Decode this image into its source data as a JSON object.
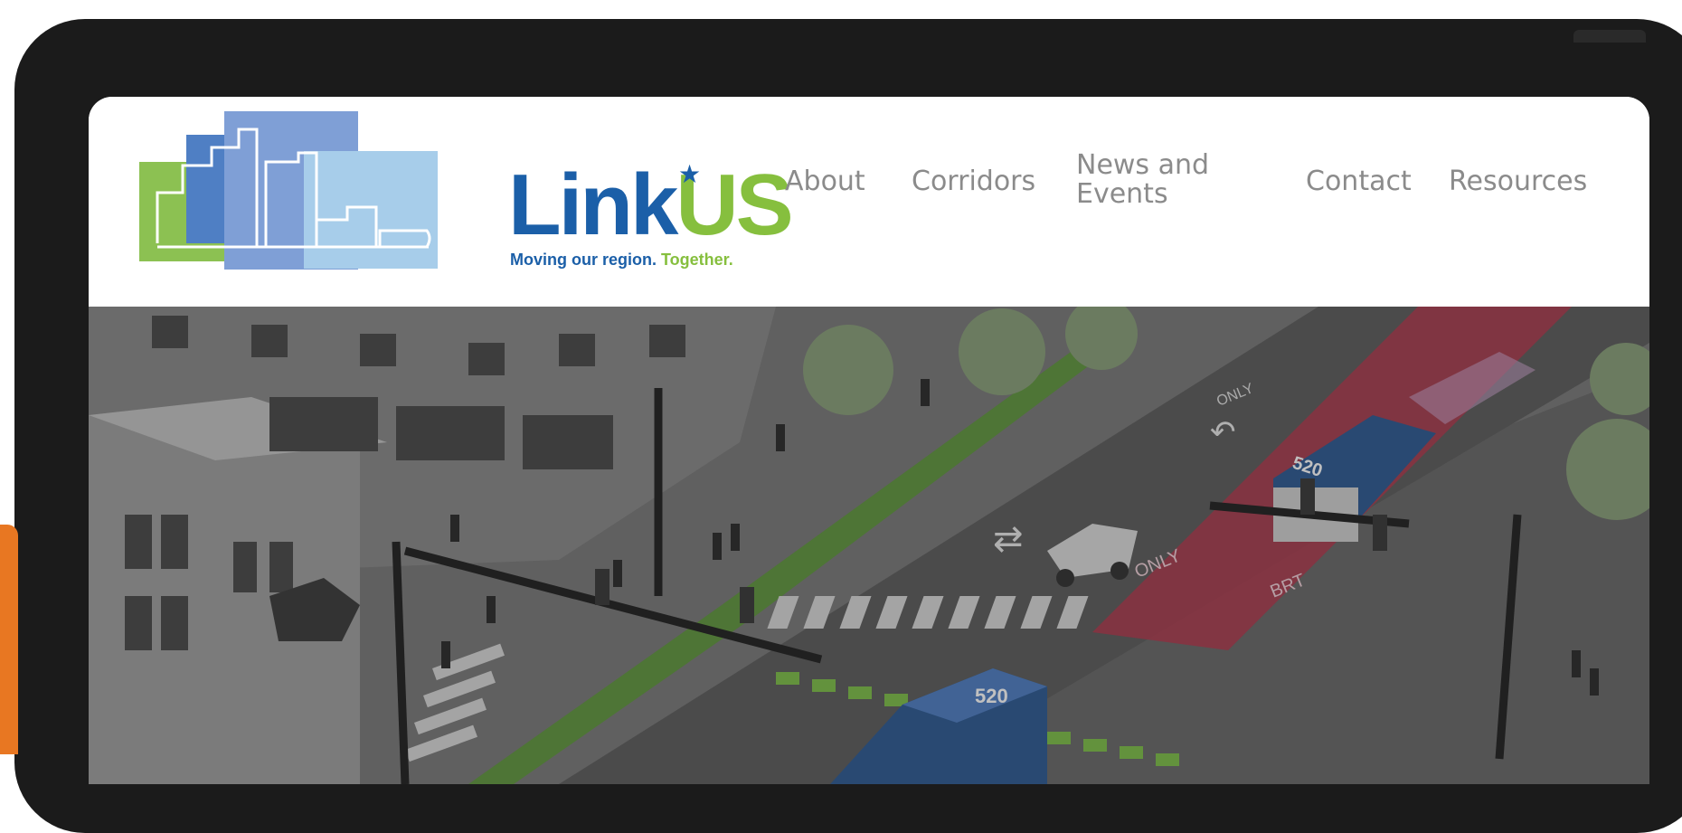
{
  "logo": {
    "word_link": "Link",
    "word_us": "US",
    "tagline_blue": "Moving our region.",
    "tagline_green": "Together.",
    "brand_blue": "#1b5fa8",
    "brand_green": "#86bf3e"
  },
  "nav": {
    "items": [
      {
        "label": "About"
      },
      {
        "label": "Corridors"
      },
      {
        "label": "News and Events"
      },
      {
        "label": "Contact"
      },
      {
        "label": "Resources"
      }
    ]
  },
  "hero": {
    "bus_number_front": "520",
    "bus_number_rear": "520",
    "lane_text_1": "ONLY",
    "lane_text_2": "BRT",
    "lane_text_3": "ONLY",
    "accent_red": "#b43a4f",
    "bike_lane_green": "#5f9a3a"
  },
  "side_tab": {
    "color": "#e87722"
  }
}
